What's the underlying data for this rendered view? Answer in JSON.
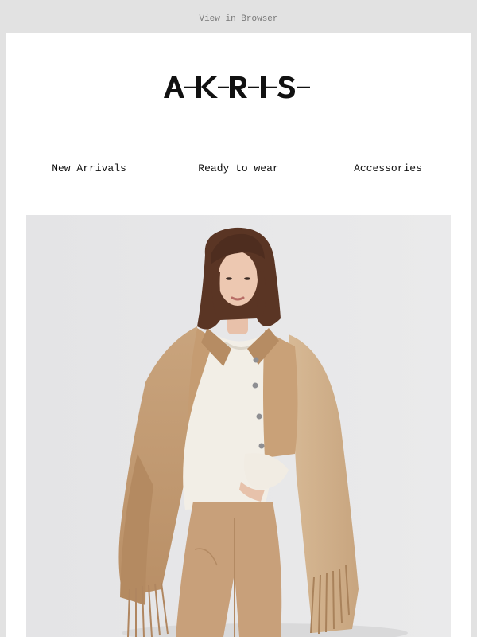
{
  "header": {
    "view_in_browser": "View in Browser"
  },
  "brand": {
    "logo_text": "A-K-R-I-S-"
  },
  "nav": {
    "items": [
      {
        "label": "New Arrivals"
      },
      {
        "label": "Ready to wear"
      },
      {
        "label": "Accessories"
      }
    ]
  },
  "hero": {
    "image_description_icon": "fashion-model-photo",
    "colors": {
      "camel": "#c79f77",
      "camel_dark": "#a57c55",
      "cream": "#f3efe7",
      "hair": "#5a3524",
      "background": "#e5e5e6"
    }
  }
}
